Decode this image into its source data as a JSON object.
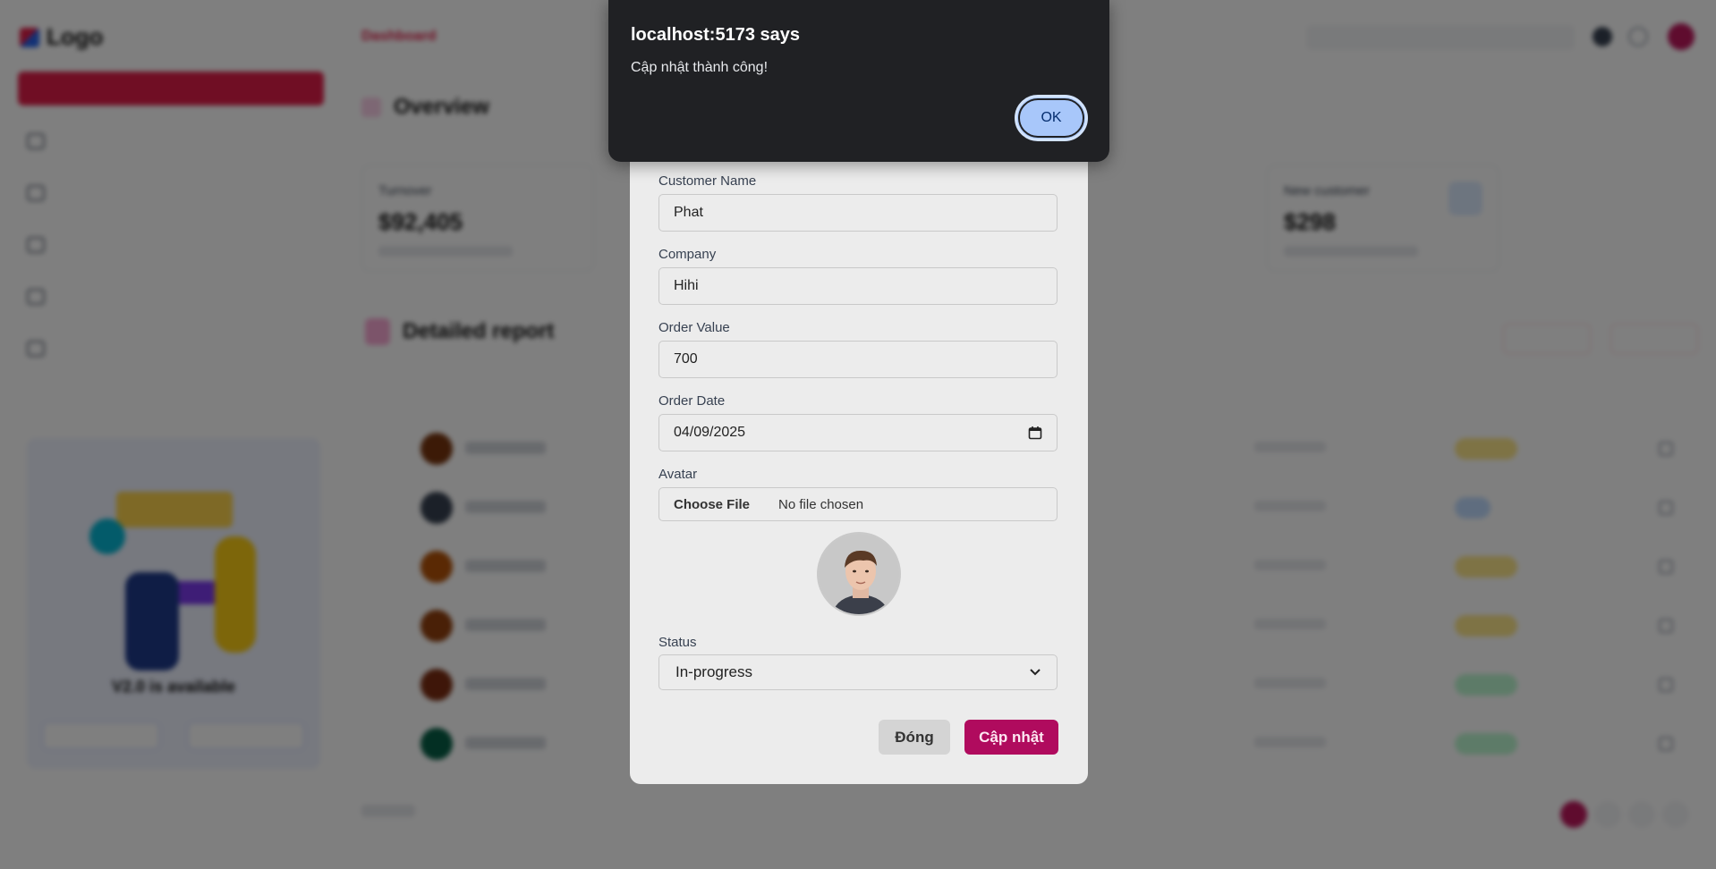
{
  "app": {
    "logo_text": "Logo",
    "breadcrumb": "Dashboard",
    "overview_title": "Overview",
    "detail_title": "Detailed report",
    "promo_title": "V2.0 is available",
    "cards": [
      {
        "label": "Turnover",
        "value": "$92,405"
      },
      {
        "label": "New customer",
        "value": "$298"
      }
    ]
  },
  "modal": {
    "customer_name_label": "Customer Name",
    "customer_name_value": "Phat",
    "company_label": "Company",
    "company_value": "Hihi",
    "order_value_label": "Order Value",
    "order_value_value": "700",
    "order_date_label": "Order Date",
    "order_date_value": "04/09/2025",
    "avatar_label": "Avatar",
    "choose_file_label": "Choose File",
    "no_file_text": "No file chosen",
    "status_label": "Status",
    "status_value": "In-progress",
    "close_label": "Đóng",
    "update_label": "Cập nhật"
  },
  "alert": {
    "title": "localhost:5173 says",
    "message": "Cập nhật thành công!",
    "ok_label": "OK"
  },
  "colors": {
    "accent": "#b00b5e",
    "alert_bg": "#202124",
    "ok_button": "#a8c7fa"
  }
}
